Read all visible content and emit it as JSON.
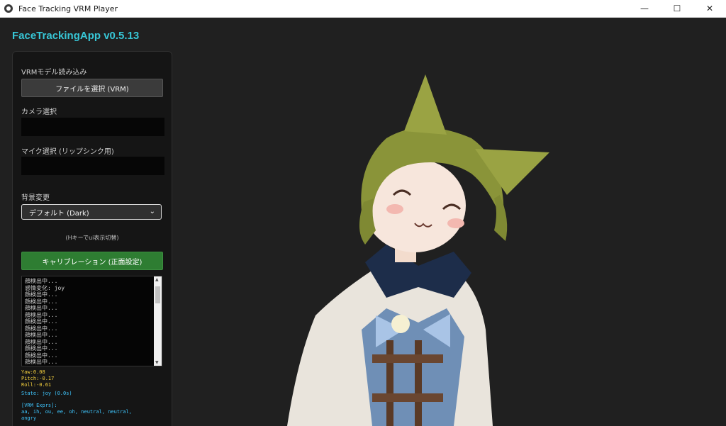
{
  "window": {
    "title": "Face Tracking VRM Player",
    "minimize": "—",
    "maximize": "☐",
    "close": "✕"
  },
  "app": {
    "title": "FaceTrackingApp v0.5.13"
  },
  "panel": {
    "vrm_label": "VRMモデル読み込み",
    "file_button": "ファイルを選択 (VRM)",
    "camera_label": "カメラ選択",
    "mic_label": "マイク選択 (リップシンク用)",
    "bg_label": "背景変更",
    "bg_value": "デフォルト (Dark)",
    "hint": "(Hキーでui表示切替)",
    "calibrate": "キャリブレーション (正面設定)",
    "log": [
      "顔検出中...",
      "感情変化: joy",
      "顔検出中...",
      "顔検出中...",
      "顔検出中...",
      "顔検出中...",
      "顔検出中...",
      "顔検出中...",
      "顔検出中...",
      "顔検出中...",
      "顔検出中...",
      "顔検出中...",
      "顔検出中..."
    ],
    "yaw": "Yaw:0.08",
    "pitch": "Pitch:-0.17",
    "roll": "Roll:-0.61",
    "state": "State: joy (0.0s)",
    "exprs_title": "[VRM Exprs]:",
    "exprs_line1": "aa, ih, ou, ee, oh, neutral, neutral,",
    "exprs_line2": "angry"
  },
  "colors": {
    "accent": "#37c6d6",
    "calibrate_green": "#2e7d32",
    "pose_yellow": "#f7d23e",
    "state_cyan": "#3fc7ff"
  }
}
